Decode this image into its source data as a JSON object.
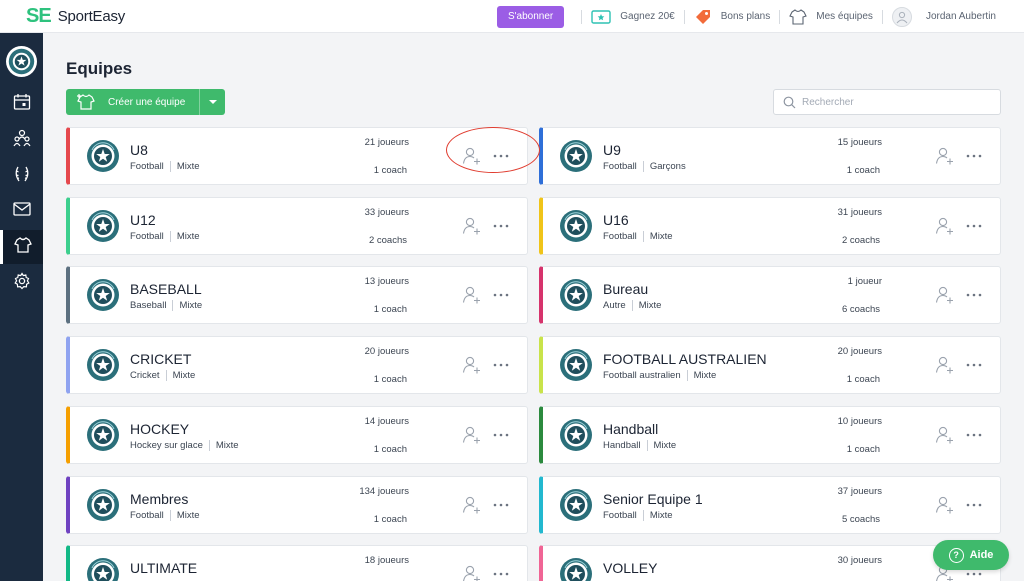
{
  "app": {
    "logo_mark": "SE",
    "logo_text": "SportEasy"
  },
  "topbar": {
    "subscribe_label": "S'abonner",
    "earn_label": "Gagnez 20€",
    "deals_label": "Bons plans",
    "teams_label": "Mes équipes",
    "user_name": "Jordan Aubertin"
  },
  "page": {
    "title": "Equipes",
    "create_label": "Créer une équipe",
    "search_placeholder": "Rechercher"
  },
  "teams": [
    {
      "name": "U8",
      "sport": "Football",
      "gender": "Mixte",
      "players": "21 joueurs",
      "coaches": "1 coach",
      "color": "#e5484d"
    },
    {
      "name": "U9",
      "sport": "Football",
      "gender": "Garçons",
      "players": "15 joueurs",
      "coaches": "1 coach",
      "color": "#2f6fd8"
    },
    {
      "name": "U12",
      "sport": "Football",
      "gender": "Mixte",
      "players": "33 joueurs",
      "coaches": "2 coachs",
      "color": "#3ccf8e"
    },
    {
      "name": "U16",
      "sport": "Football",
      "gender": "Mixte",
      "players": "31 joueurs",
      "coaches": "2 coachs",
      "color": "#f0c419"
    },
    {
      "name": "BASEBALL",
      "sport": "Baseball",
      "gender": "Mixte",
      "players": "13 joueurs",
      "coaches": "1 coach",
      "color": "#5c7080"
    },
    {
      "name": "Bureau",
      "sport": "Autre",
      "gender": "Mixte",
      "players": "1 joueur",
      "coaches": "6 coachs",
      "color": "#d6336c"
    },
    {
      "name": "CRICKET",
      "sport": "Cricket",
      "gender": "Mixte",
      "players": "20 joueurs",
      "coaches": "1 coach",
      "color": "#8fa3f0"
    },
    {
      "name": "FOOTBALL AUSTRALIEN",
      "sport": "Football australien",
      "gender": "Mixte",
      "players": "20 joueurs",
      "coaches": "1 coach",
      "color": "#c9e34a"
    },
    {
      "name": "HOCKEY",
      "sport": "Hockey sur glace",
      "gender": "Mixte",
      "players": "14 joueurs",
      "coaches": "1 coach",
      "color": "#f59f00"
    },
    {
      "name": "Handball",
      "sport": "Handball",
      "gender": "Mixte",
      "players": "10 joueurs",
      "coaches": "1 coach",
      "color": "#2b8a3e"
    },
    {
      "name": "Membres",
      "sport": "Football",
      "gender": "Mixte",
      "players": "134 joueurs",
      "coaches": "1 coach",
      "color": "#6f42c1"
    },
    {
      "name": "Senior Equipe 1",
      "sport": "Football",
      "gender": "Mixte",
      "players": "37 joueurs",
      "coaches": "5 coachs",
      "color": "#22b8cf"
    },
    {
      "name": "ULTIMATE",
      "sport": "",
      "gender": "",
      "players": "18 joueurs",
      "coaches": "",
      "color": "#12b886"
    },
    {
      "name": "VOLLEY",
      "sport": "",
      "gender": "",
      "players": "30 joueurs",
      "coaches": "",
      "color": "#f06595"
    }
  ],
  "help": {
    "label": "Aide"
  },
  "colors": {
    "accent_green": "#3fba6c",
    "sidebar": "#1b2b3f",
    "subscribe": "#9b5de5",
    "highlight": "#e03c2f"
  }
}
